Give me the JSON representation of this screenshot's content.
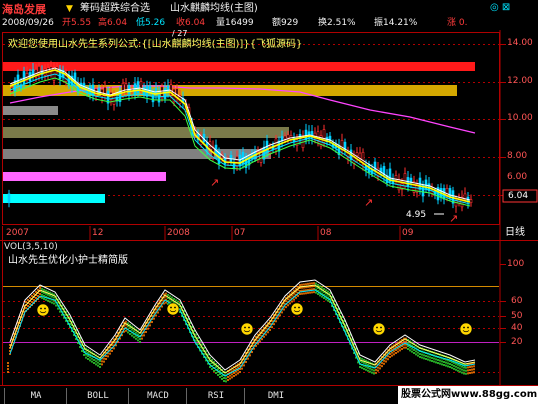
{
  "title_bar": {
    "app_name": "海岛发展",
    "screener": "筹码超跌综合选",
    "indicator_title": "山水麒麟均线(主图)",
    "date": "2008/09/26",
    "open": "开5.55",
    "high": "高6.04",
    "low": "低5.26",
    "close": "收6.04",
    "volume": "量16499",
    "amount": "额929",
    "turnover": "换2.51%",
    "amplitude": "振14.21%",
    "change": "涨 0.",
    "window_icons": "◎ ⊠"
  },
  "main_chart": {
    "welcome_text": "欢迎您使用山水先生系列公式:{[山水麒麟均线(主图)]}{飞狐源码}",
    "marker": "/ 27",
    "price_axis": [
      "14.00",
      "12.00",
      "10.00",
      "8.00",
      "6.00"
    ],
    "current_price": "6.04",
    "low_label": "4.95",
    "time_axis": [
      "2007",
      "12",
      "2008",
      "07",
      "08",
      "09"
    ],
    "period_label": "日线"
  },
  "sub_chart": {
    "header": "VOL(3,5,10)",
    "title": "山水先生优化小护士精简版",
    "axis": [
      "100",
      "60",
      "50",
      "40",
      "20"
    ]
  },
  "bottom_tabs": [
    "MA",
    "BOLL",
    "MACD",
    "RSI",
    "DMI"
  ],
  "watermark": "股票公式网www.88gg.com",
  "colors": {
    "background": "#000000",
    "axis": "#c00000",
    "up_candle": "#ff3030",
    "down_candle": "#00d0ff",
    "ma_fast": "#ffff00",
    "ma_slow": "#ff00ff"
  }
}
